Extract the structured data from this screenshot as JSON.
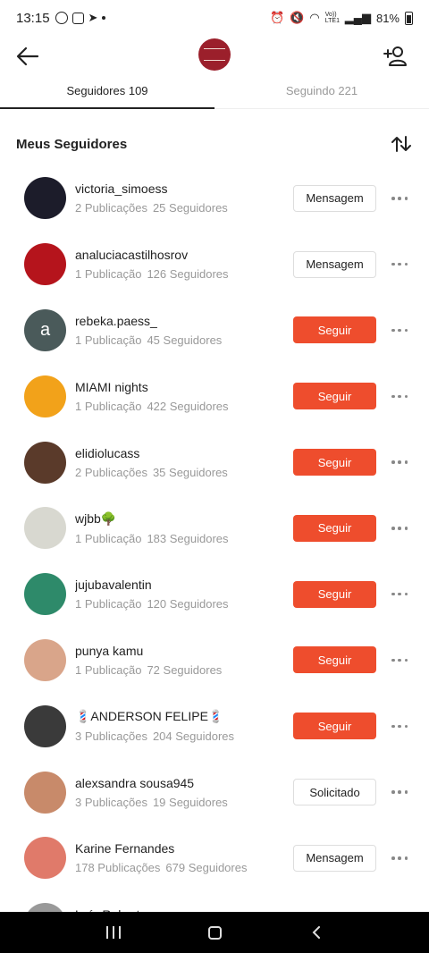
{
  "status_bar": {
    "time": "13:15",
    "network": "Vo)) LTE1",
    "battery": "81%"
  },
  "tabs": [
    {
      "label": "Seguidores 109",
      "active": true
    },
    {
      "label": "Seguindo 221",
      "active": false
    }
  ],
  "section": {
    "title": "Meus Seguidores"
  },
  "followers": [
    {
      "name": "victoria_simoess",
      "posts": "2 Publicações",
      "followers": "25 Seguidores",
      "action": "Mensagem",
      "style": "outline",
      "avatar_color": "#1c1c2a",
      "avatar_letter": ""
    },
    {
      "name": "analuciacastilhosrov",
      "posts": "1 Publicação",
      "followers": "126 Seguidores",
      "action": "Mensagem",
      "style": "outline",
      "avatar_color": "#b5141c",
      "avatar_letter": ""
    },
    {
      "name": "rebeka.paess_",
      "posts": "1 Publicação",
      "followers": "45 Seguidores",
      "action": "Seguir",
      "style": "follow",
      "avatar_color": "#4a5a5a",
      "avatar_letter": "a"
    },
    {
      "name": "MIAMI nights",
      "posts": "1 Publicação",
      "followers": "422 Seguidores",
      "action": "Seguir",
      "style": "follow",
      "avatar_color": "#f2a21a",
      "avatar_letter": ""
    },
    {
      "name": "elidiolucass",
      "posts": "2 Publicações",
      "followers": "35 Seguidores",
      "action": "Seguir",
      "style": "follow",
      "avatar_color": "#5a3a2a",
      "avatar_letter": ""
    },
    {
      "name": "wjbb🌳",
      "posts": "1 Publicação",
      "followers": "183 Seguidores",
      "action": "Seguir",
      "style": "follow",
      "avatar_color": "#d8d8d0",
      "avatar_letter": ""
    },
    {
      "name": "jujubavalentin",
      "posts": "1 Publicação",
      "followers": "120 Seguidores",
      "action": "Seguir",
      "style": "follow",
      "avatar_color": "#2e8a6a",
      "avatar_letter": ""
    },
    {
      "name": "punya kamu",
      "posts": "1 Publicação",
      "followers": "72 Seguidores",
      "action": "Seguir",
      "style": "follow",
      "avatar_color": "#d9a58a",
      "avatar_letter": ""
    },
    {
      "name": "💈ANDERSON FELIPE💈",
      "posts": "3 Publicações",
      "followers": "204 Seguidores",
      "action": "Seguir",
      "style": "follow",
      "avatar_color": "#3a3a3a",
      "avatar_letter": ""
    },
    {
      "name": "alexsandra sousa945",
      "posts": "3 Publicações",
      "followers": "19 Seguidores",
      "action": "Solicitado",
      "style": "outline",
      "avatar_color": "#c88a6a",
      "avatar_letter": ""
    },
    {
      "name": "Karine Fernandes",
      "posts": "178 Publicações",
      "followers": "679 Seguidores",
      "action": "Mensagem",
      "style": "outline",
      "avatar_color": "#e07a6a",
      "avatar_letter": ""
    },
    {
      "name": "Luís Roberto",
      "posts": "",
      "followers": "",
      "action": "",
      "style": "outline",
      "avatar_color": "#999999",
      "avatar_letter": ""
    }
  ],
  "colors": {
    "accent": "#ee4d2d"
  }
}
